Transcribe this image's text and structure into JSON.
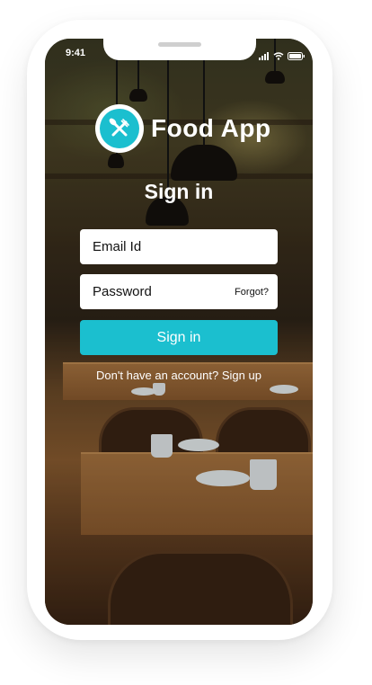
{
  "status_bar": {
    "time": "9:41",
    "icons": [
      "signal-icon",
      "wifi-icon",
      "battery-icon"
    ]
  },
  "brand": {
    "name": "Food App",
    "logo_icon": "fork-knife-icon",
    "accent_color": "#1bbfcf"
  },
  "signin_form": {
    "title": "Sign in",
    "email_placeholder": "Email Id",
    "password_placeholder": "Password",
    "forgot_label": "Forgot?",
    "submit_label": "Sign in"
  },
  "signup_prompt": {
    "text": "Don't have an account?",
    "link_label": "Sign up"
  }
}
